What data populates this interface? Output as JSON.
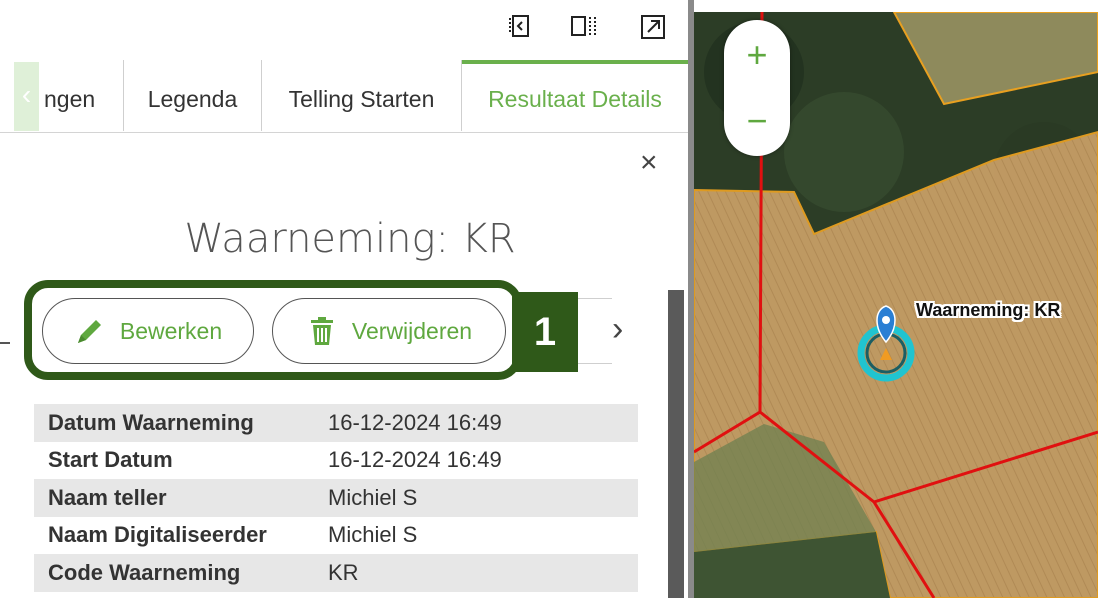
{
  "toolbar": {
    "icons": [
      "collapse-panel-icon",
      "split-view-icon",
      "open-external-icon"
    ]
  },
  "tabs": [
    {
      "label": "ngen"
    },
    {
      "label": "Legenda"
    },
    {
      "label": "Telling Starten"
    },
    {
      "label": "Resultaat Details",
      "active": true
    }
  ],
  "details": {
    "title": "Waarneming: KR",
    "close_label": "×",
    "actions": {
      "edit_label": "Bewerken",
      "delete_label": "Verwijderen"
    },
    "callout_number": "1",
    "rows": [
      {
        "key": "Datum Waarneming",
        "value": "16-12-2024 16:49"
      },
      {
        "key": "Start Datum",
        "value": "16-12-2024 16:49"
      },
      {
        "key": "Naam teller",
        "value": "Michiel S"
      },
      {
        "key": "Naam Digitaliseerder",
        "value": "Michiel S"
      },
      {
        "key": "Code Waarneming",
        "value": "KR"
      }
    ]
  },
  "map": {
    "zoom_in": "+",
    "zoom_out": "−",
    "marker_label": "Waarneming: KR",
    "colors": {
      "parcel_fill": "#c9a46a",
      "parcel_border": "#e8a020",
      "boundary_line": "#e01010",
      "forest": "#2c3d26",
      "marker_ring": "#20c4d0",
      "marker_pin": "#2a7fd4"
    }
  },
  "colors": {
    "accent": "#6ab04c",
    "highlight": "#2f5919"
  }
}
